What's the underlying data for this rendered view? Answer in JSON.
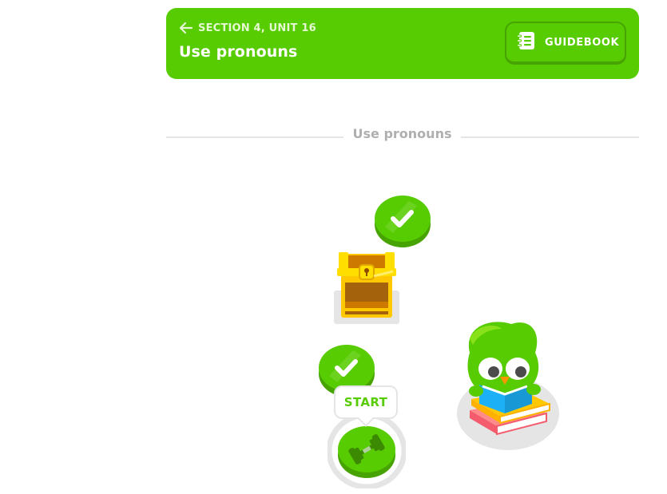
{
  "header": {
    "section_label": "SECTION 4, UNIT 16",
    "title": "Use pronouns",
    "guidebook_label": "GUIDEBOOK",
    "background_color": "#58cc02",
    "back_icon": "arrow-left-icon",
    "guidebook_icon": "notebook-icon"
  },
  "path": {
    "section_divider_title": "Use pronouns",
    "start_label": "START",
    "nodes": [
      {
        "type": "lesson",
        "state": "completed",
        "icon": "checkmark-icon"
      },
      {
        "type": "treasure-chest",
        "state": "unlocked",
        "icon": "treasure-chest-icon"
      },
      {
        "type": "lesson",
        "state": "completed",
        "icon": "checkmark-icon"
      },
      {
        "type": "practice",
        "state": "current",
        "icon": "dumbbell-icon"
      }
    ],
    "mascot": "duo-reading-icon"
  }
}
